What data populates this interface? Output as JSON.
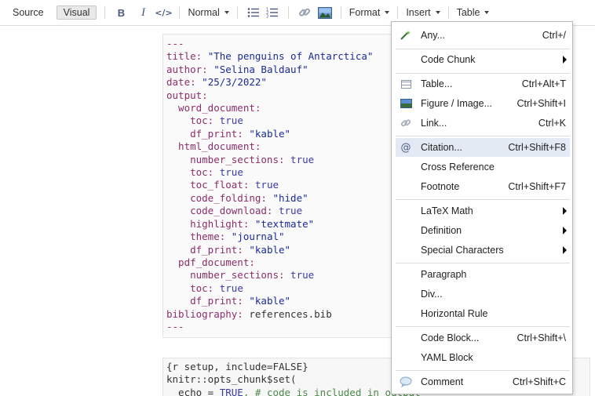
{
  "toolbar": {
    "source_label": "Source",
    "visual_label": "Visual",
    "bold_label": "B",
    "italic_label": "I",
    "code_label": "</>",
    "style_select": "Normal",
    "format_label": "Format",
    "insert_label": "Insert",
    "table_label": "Table"
  },
  "yaml": {
    "l1": "---",
    "l2k": "title:",
    "l2v": "\"The penguins of Antarctica\"",
    "l3k": "author:",
    "l3v": "\"Selina Baldauf\"",
    "l4k": "date:",
    "l4v": "\"25/3/2022\"",
    "l5k": "output:",
    "l6k": "  word_document:",
    "l7k": "    toc:",
    "l7v": "true",
    "l8k": "    df_print:",
    "l8v": "\"kable\"",
    "l9k": "  html_document:",
    "l10k": "    number_sections:",
    "l10v": "true",
    "l11k": "    toc:",
    "l11v": "true",
    "l12k": "    toc_float:",
    "l12v": "true",
    "l13k": "    code_folding:",
    "l13v": "\"hide\"",
    "l14k": "    code_download:",
    "l14v": "true",
    "l15k": "    highlight:",
    "l15v": "\"textmate\"",
    "l16k": "    theme:",
    "l16v": "\"journal\"",
    "l17k": "    df_print:",
    "l17v": "\"kable\"",
    "l18k": "  pdf_document:",
    "l19k": "    number_sections:",
    "l19v": "true",
    "l20k": "    toc:",
    "l20v": "true",
    "l21k": "    df_print:",
    "l21v": "\"kable\"",
    "l22k": "bibliography:",
    "l22v": "references.bib",
    "l23": "---"
  },
  "chunk": {
    "l1": "{r setup, include=FALSE}",
    "l2a": "knitr::opts_chunk$set(",
    "l3a": "  echo = ",
    "l3b": "TRUE",
    "l3c": ", # code is included in output"
  },
  "menu": {
    "any": {
      "label": "Any...",
      "shortcut": "Ctrl+/"
    },
    "code_chunk": {
      "label": "Code Chunk"
    },
    "table": {
      "label": "Table...",
      "shortcut": "Ctrl+Alt+T"
    },
    "figure": {
      "label": "Figure / Image...",
      "shortcut": "Ctrl+Shift+I"
    },
    "link": {
      "label": "Link...",
      "shortcut": "Ctrl+K"
    },
    "citation": {
      "label": "Citation...",
      "shortcut": "Ctrl+Shift+F8"
    },
    "cross_reference": {
      "label": "Cross Reference"
    },
    "footnote": {
      "label": "Footnote",
      "shortcut": "Ctrl+Shift+F7"
    },
    "latex_math": {
      "label": "LaTeX Math"
    },
    "definition": {
      "label": "Definition"
    },
    "special_characters": {
      "label": "Special Characters"
    },
    "paragraph": {
      "label": "Paragraph"
    },
    "div": {
      "label": "Div..."
    },
    "horizontal_rule": {
      "label": "Horizontal Rule"
    },
    "code_block": {
      "label": "Code Block...",
      "shortcut": "Ctrl+Shift+\\"
    },
    "yaml_block": {
      "label": "YAML Block"
    },
    "comment": {
      "label": "Comment",
      "shortcut": "Ctrl+Shift+C"
    }
  },
  "icons": {
    "any": "magic-wand-icon",
    "table": "table-icon",
    "figure": "image-icon",
    "link": "link-icon",
    "citation": "at-sign-icon",
    "comment": "speech-bubble-icon"
  },
  "colors": {
    "highlight": "#e4eaf4",
    "yaml_key": "#8b2e6b",
    "yaml_string": "#1a2a9a"
  }
}
